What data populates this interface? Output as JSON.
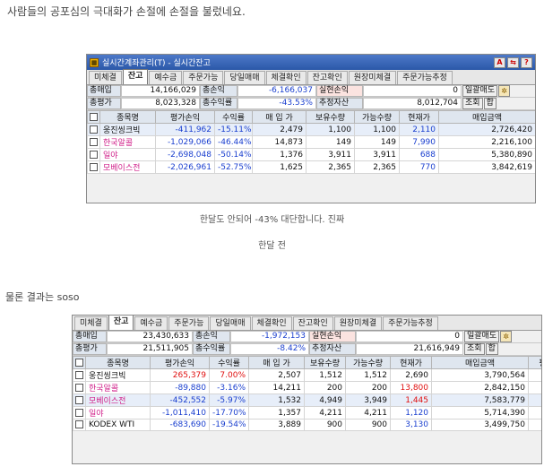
{
  "intro": "사람들의 공포심의 극대화가 손절에 손절을 불렀네요.",
  "caption1": "한달도 안되어 -43% 대단합니다. 진짜",
  "caption2": "한달 전",
  "outro": "물론 결과는 soso",
  "window1": {
    "title": "실시간계좌관리(T) - 실시간잔고",
    "title_buttons": [
      "A",
      "⇆",
      "?"
    ],
    "tabs": [
      "미체결",
      "잔고",
      "예수금",
      "주문가능",
      "당일매매",
      "체결확인",
      "잔고확인",
      "원장미체결",
      "주문가능추정"
    ],
    "summary": {
      "buy_label": "총매입",
      "buy_value": "14,166,029",
      "pnl_label": "총손익",
      "pnl_value": "-6,166,037",
      "realized_label": "실현손익",
      "realized_value": "0",
      "sell_button": "일괄매도",
      "eval_label": "총평가",
      "eval_value": "8,023,328",
      "rate_label": "총수익률",
      "rate_value": "-43.53%",
      "est_label": "추정자산",
      "est_value": "8,012,704",
      "query_button": "조회",
      "sum_button": "합"
    },
    "columns": [
      "종목명",
      "평가손익",
      "수익률",
      "매 입 가",
      "보유수량",
      "가능수량",
      "현재가",
      "매입금액"
    ],
    "rows": [
      {
        "name": "웅진씽크빅",
        "pnl": "-411,962",
        "rate": "-15.11%",
        "avg": "2,479",
        "qty": "1,100",
        "avail": "1,100",
        "price": "2,110",
        "cost": "2,726,420"
      },
      {
        "name": "한국알콜",
        "pnl": "-1,029,066",
        "rate": "-46.44%",
        "avg": "14,873",
        "qty": "149",
        "avail": "149",
        "price": "7,990",
        "cost": "2,216,100"
      },
      {
        "name": "일야",
        "pnl": "-2,698,048",
        "rate": "-50.14%",
        "avg": "1,376",
        "qty": "3,911",
        "avail": "3,911",
        "price": "688",
        "cost": "5,380,890"
      },
      {
        "name": "모베이스전",
        "pnl": "-2,026,961",
        "rate": "-52.75%",
        "avg": "1,625",
        "qty": "2,365",
        "avail": "2,365",
        "price": "770",
        "cost": "3,842,619"
      }
    ]
  },
  "window2": {
    "tabs": [
      "미체결",
      "잔고",
      "예수금",
      "주문가능",
      "당일매매",
      "체결확인",
      "잔고확인",
      "원장미체결",
      "주문가능추정"
    ],
    "summary": {
      "buy_label": "총매입",
      "buy_value": "23,430,633",
      "pnl_label": "총손익",
      "pnl_value": "-1,972,153",
      "realized_label": "실현손익",
      "realized_value": "0",
      "sell_button": "일괄매도",
      "eval_label": "총평가",
      "eval_value": "21,511,905",
      "rate_label": "총수익률",
      "rate_value": "-8.42%",
      "est_label": "추정자산",
      "est_value": "21,616,949",
      "query_button": "조회",
      "sum_button": "합"
    },
    "columns": [
      "종목명",
      "평가손익",
      "수익률",
      "매 입 가",
      "보유수량",
      "가능수량",
      "현재가",
      "매입금액",
      "평"
    ],
    "rows": [
      {
        "name": "웅진씽크빅",
        "pnl": "265,379",
        "rate": "7.00%",
        "avg": "2,507",
        "qty": "1,512",
        "avail": "1,512",
        "price": "2,690",
        "cost": "3,790,564"
      },
      {
        "name": "한국알콜",
        "pnl": "-89,880",
        "rate": "-3.16%",
        "avg": "14,211",
        "qty": "200",
        "avail": "200",
        "price": "13,800",
        "cost": "2,842,150"
      },
      {
        "name": "모베이스전",
        "pnl": "-452,552",
        "rate": "-5.97%",
        "avg": "1,532",
        "qty": "4,949",
        "avail": "3,949",
        "price": "1,445",
        "cost": "7,583,779"
      },
      {
        "name": "일야",
        "pnl": "-1,011,410",
        "rate": "-17.70%",
        "avg": "1,357",
        "qty": "4,211",
        "avail": "4,211",
        "price": "1,120",
        "cost": "5,714,390"
      },
      {
        "name": "KODEX WTI",
        "pnl": "-683,690",
        "rate": "-19.54%",
        "avg": "3,889",
        "qty": "900",
        "avail": "900",
        "price": "3,130",
        "cost": "3,499,750"
      }
    ]
  },
  "colors": {
    "blue": "#1a3fcf",
    "red": "#e01010",
    "pink": "#d0208a",
    "title_bar": "#2b58a8"
  }
}
